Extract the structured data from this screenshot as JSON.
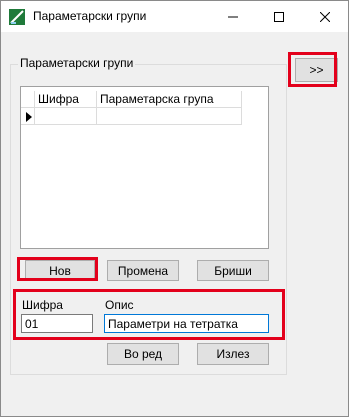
{
  "window": {
    "title": "Параметарски групи",
    "controls": {
      "minimize": "minimize-icon",
      "maximize": "maximize-icon",
      "close": "close-icon"
    }
  },
  "expand_button": {
    "label": ">>"
  },
  "group": {
    "legend": "Параметарски групи",
    "grid": {
      "columns": [
        "Шифра",
        "Параметарска група"
      ],
      "rows": [
        [
          "",
          ""
        ]
      ]
    }
  },
  "actions": {
    "new": "Нов",
    "edit": "Промена",
    "delete": "Бриши"
  },
  "form": {
    "code_label": "Шифра",
    "code_value": "01",
    "desc_label": "Опис",
    "desc_value": "Параметри на тетратка"
  },
  "footer": {
    "ok": "Во ред",
    "exit": "Излез"
  },
  "colors": {
    "highlight": "#e3001b",
    "focus_border": "#0078d7"
  }
}
